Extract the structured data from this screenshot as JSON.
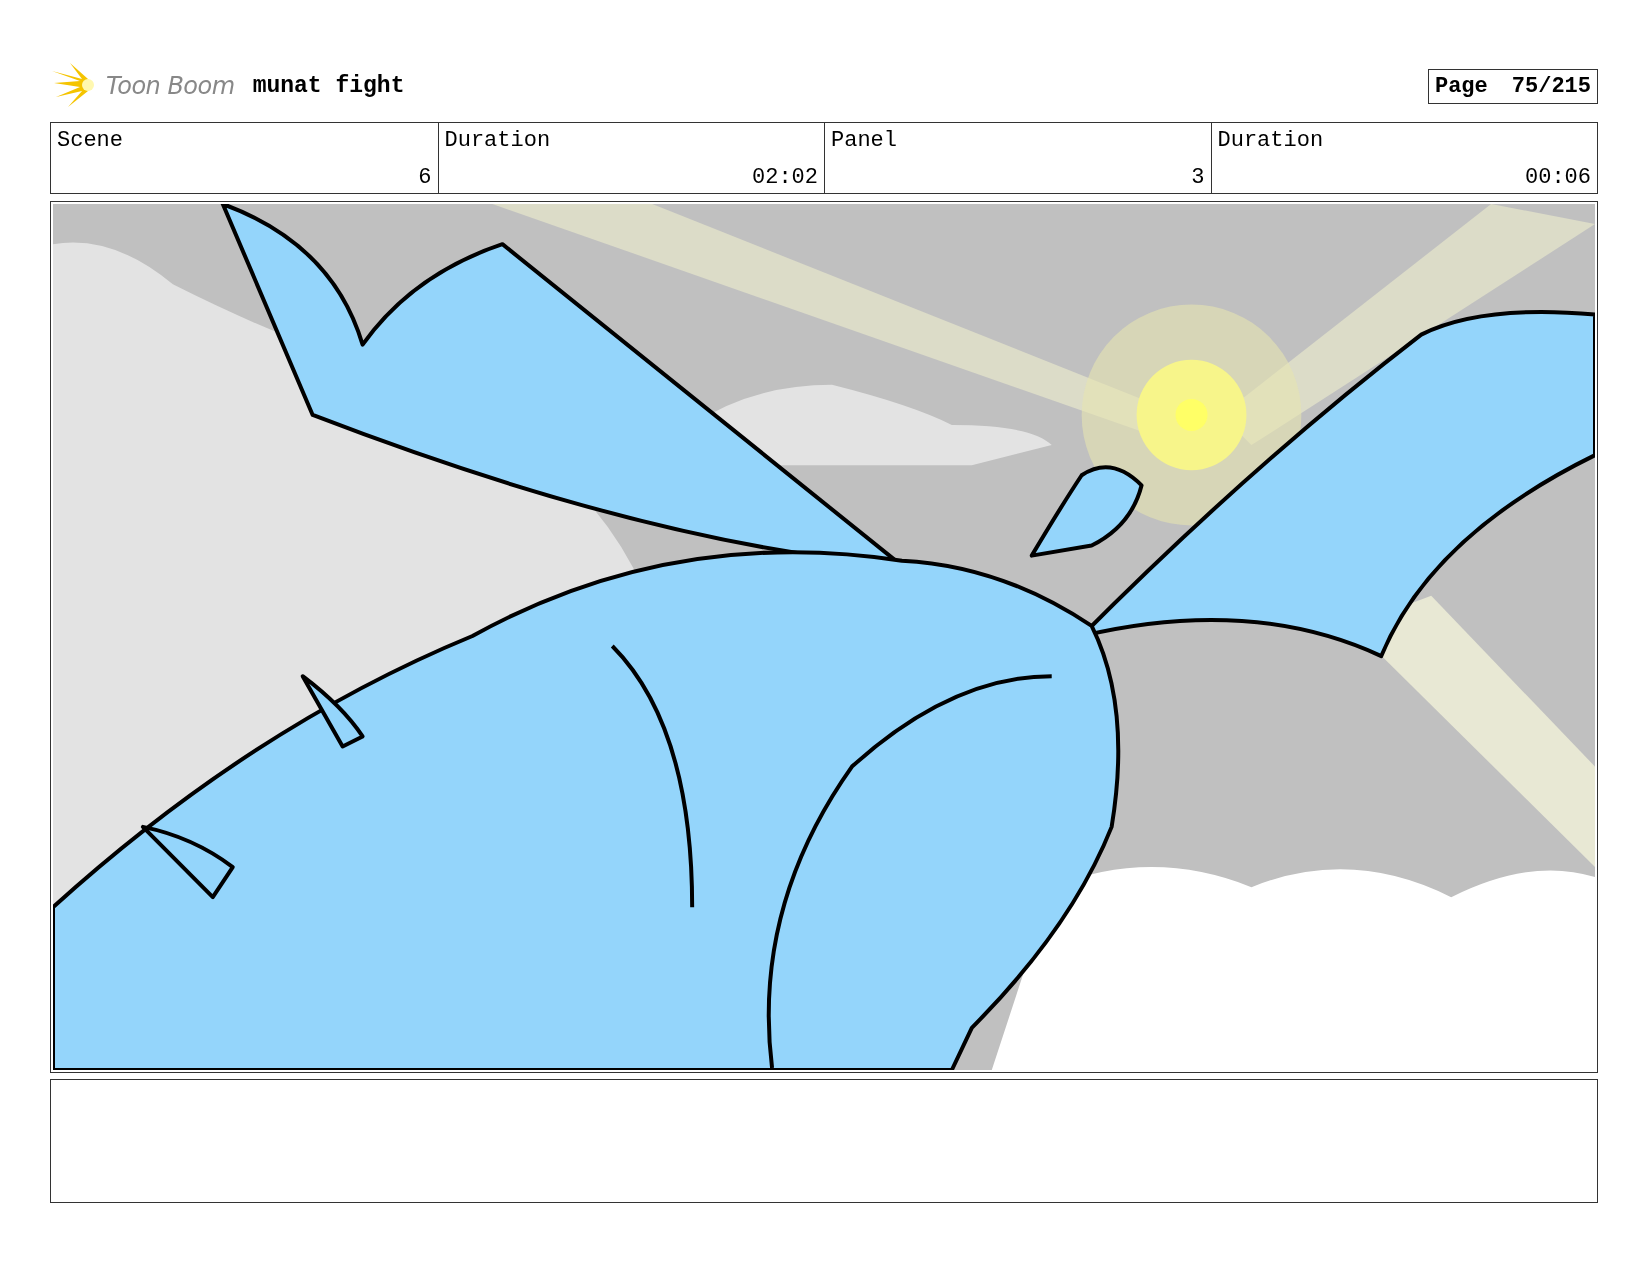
{
  "header": {
    "logo_text": "Toon Boom",
    "project_title": "munat fight",
    "page_label": "Page",
    "page_number": "75/215"
  },
  "info_table": {
    "labels": [
      "Scene",
      "Duration",
      "Panel",
      "Duration"
    ],
    "values": [
      "6",
      "02:02",
      "3",
      "00:06"
    ]
  }
}
